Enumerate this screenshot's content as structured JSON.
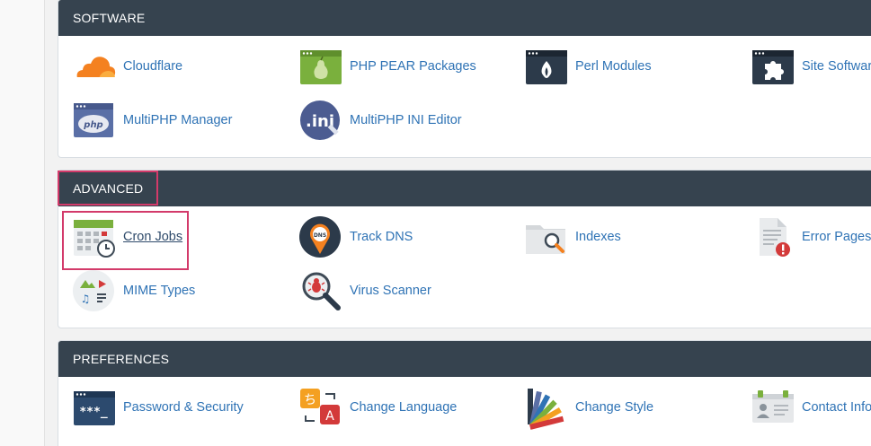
{
  "sections": {
    "software": {
      "title": "SOFTWARE",
      "items": [
        {
          "label": "Cloudflare",
          "icon": "cloudflare-icon"
        },
        {
          "label": "PHP PEAR Packages",
          "icon": "php-pear-icon"
        },
        {
          "label": "Perl Modules",
          "icon": "perl-modules-icon"
        },
        {
          "label": "Site Software",
          "icon": "site-software-icon"
        },
        {
          "label": "MultiPHP Manager",
          "icon": "multiphp-manager-icon"
        },
        {
          "label": "MultiPHP INI Editor",
          "icon": "multiphp-ini-editor-icon"
        }
      ]
    },
    "advanced": {
      "title": "ADVANCED",
      "items": [
        {
          "label": "Cron Jobs",
          "icon": "cron-jobs-icon"
        },
        {
          "label": "Track DNS",
          "icon": "track-dns-icon",
          "badge": "DNS"
        },
        {
          "label": "Indexes",
          "icon": "indexes-icon"
        },
        {
          "label": "Error Pages",
          "icon": "error-pages-icon"
        },
        {
          "label": "MIME Types",
          "icon": "mime-types-icon"
        },
        {
          "label": "Virus Scanner",
          "icon": "virus-scanner-icon"
        }
      ]
    },
    "preferences": {
      "title": "PREFERENCES",
      "items": [
        {
          "label": "Password & Security",
          "icon": "password-security-icon"
        },
        {
          "label": "Change Language",
          "icon": "change-language-icon"
        },
        {
          "label": "Change Style",
          "icon": "change-style-icon"
        },
        {
          "label": "Contact Information",
          "icon": "contact-information-icon"
        }
      ]
    }
  },
  "colors": {
    "header_bg": "#36434f",
    "link": "#2f73b5",
    "highlight": "#d33a6a"
  }
}
